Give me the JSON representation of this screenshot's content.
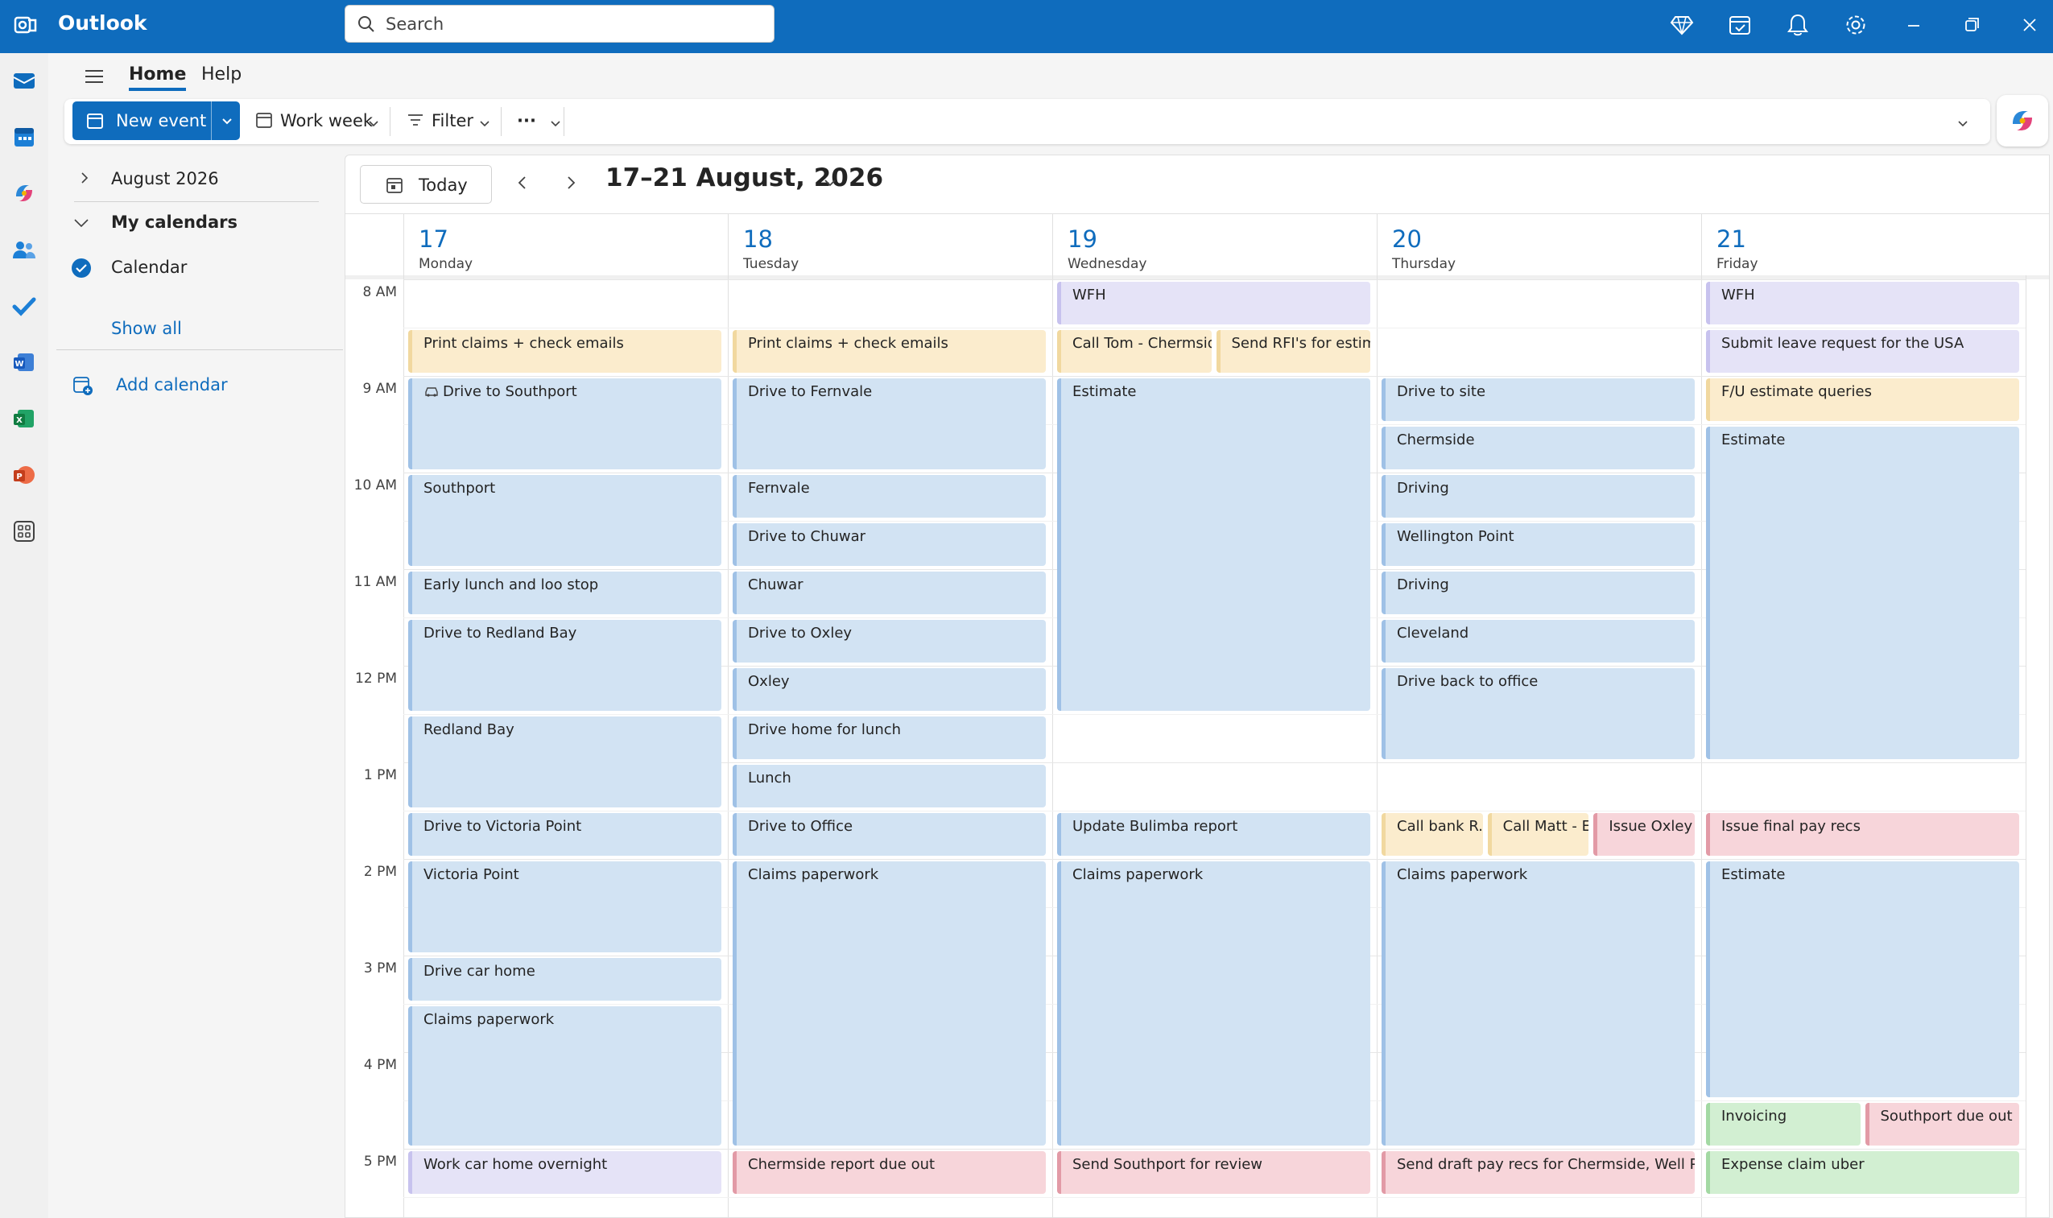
{
  "titlebar": {
    "app_name": "Outlook",
    "search_placeholder": "Search",
    "icons": [
      "premium-diamond-icon",
      "my-day-icon",
      "notifications-bell-icon",
      "settings-gear-icon",
      "minimize-icon",
      "restore-icon",
      "close-icon"
    ]
  },
  "rail": {
    "items": [
      "mail-icon",
      "calendar-icon",
      "copilot-icon",
      "people-icon",
      "todo-icon",
      "word-icon",
      "excel-icon",
      "powerpoint-icon",
      "more-apps-icon"
    ]
  },
  "ribbon": {
    "tabs": [
      "Home",
      "Help"
    ],
    "active_tab": "Home",
    "new_event_label": "New event",
    "view_label": "Work week",
    "filter_label": "Filter",
    "more_label": "···"
  },
  "navpane": {
    "month_label": "August 2026",
    "my_calendars_label": "My calendars",
    "calendar_label": "Calendar",
    "show_all_label": "Show all",
    "add_calendar_label": "Add calendar"
  },
  "calendar": {
    "today_label": "Today",
    "range_label": "17–21 August, 2026",
    "days": [
      {
        "num": "17",
        "name": "Monday"
      },
      {
        "num": "18",
        "name": "Tuesday"
      },
      {
        "num": "19",
        "name": "Wednesday"
      },
      {
        "num": "20",
        "name": "Thursday"
      },
      {
        "num": "21",
        "name": "Friday"
      }
    ],
    "hours": [
      "8 AM",
      "9 AM",
      "10 AM",
      "11 AM",
      "12 PM",
      "1 PM",
      "2 PM",
      "3 PM",
      "4 PM",
      "5 PM"
    ],
    "events": [
      {
        "day": 0,
        "start": 8.5,
        "end": 9.0,
        "title": "Print claims + check emails",
        "color": "yellow"
      },
      {
        "day": 0,
        "start": 9.0,
        "end": 10.0,
        "title": "Drive to Southport",
        "color": "blue",
        "icon": "car-icon"
      },
      {
        "day": 0,
        "start": 10.0,
        "end": 11.0,
        "title": "Southport",
        "color": "blue"
      },
      {
        "day": 0,
        "start": 11.0,
        "end": 11.5,
        "title": "Early lunch and loo stop",
        "color": "blue"
      },
      {
        "day": 0,
        "start": 11.5,
        "end": 12.5,
        "title": "Drive to Redland Bay",
        "color": "blue"
      },
      {
        "day": 0,
        "start": 12.5,
        "end": 13.5,
        "title": "Redland Bay",
        "color": "blue"
      },
      {
        "day": 0,
        "start": 13.5,
        "end": 14.0,
        "title": "Drive to Victoria Point",
        "color": "blue"
      },
      {
        "day": 0,
        "start": 14.0,
        "end": 15.0,
        "title": "Victoria Point",
        "color": "blue"
      },
      {
        "day": 0,
        "start": 15.0,
        "end": 15.5,
        "title": "Drive car home",
        "color": "blue"
      },
      {
        "day": 0,
        "start": 15.5,
        "end": 17.0,
        "title": "Claims paperwork",
        "color": "blue"
      },
      {
        "day": 0,
        "start": 17.0,
        "end": 17.5,
        "title": "Work car home overnight",
        "color": "purple"
      },
      {
        "day": 1,
        "start": 8.5,
        "end": 9.0,
        "title": "Print claims + check emails",
        "color": "yellow"
      },
      {
        "day": 1,
        "start": 9.0,
        "end": 10.0,
        "title": "Drive to Fernvale",
        "color": "blue"
      },
      {
        "day": 1,
        "start": 10.0,
        "end": 10.5,
        "title": "Fernvale",
        "color": "blue"
      },
      {
        "day": 1,
        "start": 10.5,
        "end": 11.0,
        "title": "Drive to Chuwar",
        "color": "blue"
      },
      {
        "day": 1,
        "start": 11.0,
        "end": 11.5,
        "title": "Chuwar",
        "color": "blue"
      },
      {
        "day": 1,
        "start": 11.5,
        "end": 12.0,
        "title": "Drive to Oxley",
        "color": "blue"
      },
      {
        "day": 1,
        "start": 12.0,
        "end": 12.5,
        "title": "Oxley",
        "color": "blue"
      },
      {
        "day": 1,
        "start": 12.5,
        "end": 13.0,
        "title": "Drive home for lunch",
        "color": "blue"
      },
      {
        "day": 1,
        "start": 13.0,
        "end": 13.5,
        "title": "Lunch",
        "color": "blue"
      },
      {
        "day": 1,
        "start": 13.5,
        "end": 14.0,
        "title": "Drive to Office",
        "color": "blue"
      },
      {
        "day": 1,
        "start": 14.0,
        "end": 17.0,
        "title": "Claims paperwork",
        "color": "blue"
      },
      {
        "day": 1,
        "start": 17.0,
        "end": 17.5,
        "title": "Chermside report due out",
        "color": "pink"
      },
      {
        "day": 2,
        "start": 8.0,
        "end": 8.5,
        "title": "WFH",
        "color": "purple"
      },
      {
        "day": 2,
        "start": 8.5,
        "end": 9.0,
        "title": "Call Tom - Chermsid",
        "color": "yellow",
        "col": 0,
        "cols": 2
      },
      {
        "day": 2,
        "start": 8.5,
        "end": 9.0,
        "title": "Send RFI's for estima",
        "color": "yellow",
        "col": 1,
        "cols": 2
      },
      {
        "day": 2,
        "start": 9.0,
        "end": 12.5,
        "title": "Estimate",
        "color": "blue"
      },
      {
        "day": 2,
        "start": 13.5,
        "end": 14.0,
        "title": "Update Bulimba report",
        "color": "blue"
      },
      {
        "day": 2,
        "start": 14.0,
        "end": 17.0,
        "title": "Claims paperwork",
        "color": "blue"
      },
      {
        "day": 2,
        "start": 17.0,
        "end": 17.5,
        "title": "Send Southport for review",
        "color": "pink"
      },
      {
        "day": 3,
        "start": 9.0,
        "end": 9.5,
        "title": "Drive to site",
        "color": "blue"
      },
      {
        "day": 3,
        "start": 9.5,
        "end": 10.0,
        "title": "Chermside",
        "color": "blue"
      },
      {
        "day": 3,
        "start": 10.0,
        "end": 10.5,
        "title": "Driving",
        "color": "blue"
      },
      {
        "day": 3,
        "start": 10.5,
        "end": 11.0,
        "title": "Wellington Point",
        "color": "blue"
      },
      {
        "day": 3,
        "start": 11.0,
        "end": 11.5,
        "title": "Driving",
        "color": "blue"
      },
      {
        "day": 3,
        "start": 11.5,
        "end": 12.0,
        "title": "Cleveland",
        "color": "blue"
      },
      {
        "day": 3,
        "start": 12.0,
        "end": 13.0,
        "title": "Drive back to office",
        "color": "blue"
      },
      {
        "day": 3,
        "start": 13.5,
        "end": 14.0,
        "title": "Call bank R.I",
        "color": "yellow",
        "col": 0,
        "cols": 3
      },
      {
        "day": 3,
        "start": 13.5,
        "end": 14.0,
        "title": "Call Matt - E",
        "color": "yellow",
        "col": 1,
        "cols": 3
      },
      {
        "day": 3,
        "start": 13.5,
        "end": 14.0,
        "title": "Issue Oxley r",
        "color": "pink",
        "col": 2,
        "cols": 3
      },
      {
        "day": 3,
        "start": 14.0,
        "end": 17.0,
        "title": "Claims paperwork",
        "color": "blue"
      },
      {
        "day": 3,
        "start": 17.0,
        "end": 17.5,
        "title": "Send draft pay recs for Chermside, Well Poi",
        "color": "pink"
      },
      {
        "day": 4,
        "start": 8.0,
        "end": 8.5,
        "title": "WFH",
        "color": "purple"
      },
      {
        "day": 4,
        "start": 8.5,
        "end": 9.0,
        "title": "Submit leave request for the USA",
        "color": "purple"
      },
      {
        "day": 4,
        "start": 9.0,
        "end": 9.5,
        "title": "F/U estimate queries",
        "color": "yellow"
      },
      {
        "day": 4,
        "start": 9.5,
        "end": 13.0,
        "title": "Estimate",
        "color": "blue"
      },
      {
        "day": 4,
        "start": 13.5,
        "end": 14.0,
        "title": "Issue final pay recs",
        "color": "pink"
      },
      {
        "day": 4,
        "start": 14.0,
        "end": 16.5,
        "title": "Estimate",
        "color": "blue"
      },
      {
        "day": 4,
        "start": 16.5,
        "end": 17.0,
        "title": "Invoicing",
        "color": "green",
        "col": 0,
        "cols": 2
      },
      {
        "day": 4,
        "start": 16.5,
        "end": 17.0,
        "title": "Southport due out",
        "color": "pink",
        "col": 1,
        "cols": 2
      },
      {
        "day": 4,
        "start": 17.0,
        "end": 17.5,
        "title": "Expense claim uber",
        "color": "green"
      }
    ]
  }
}
